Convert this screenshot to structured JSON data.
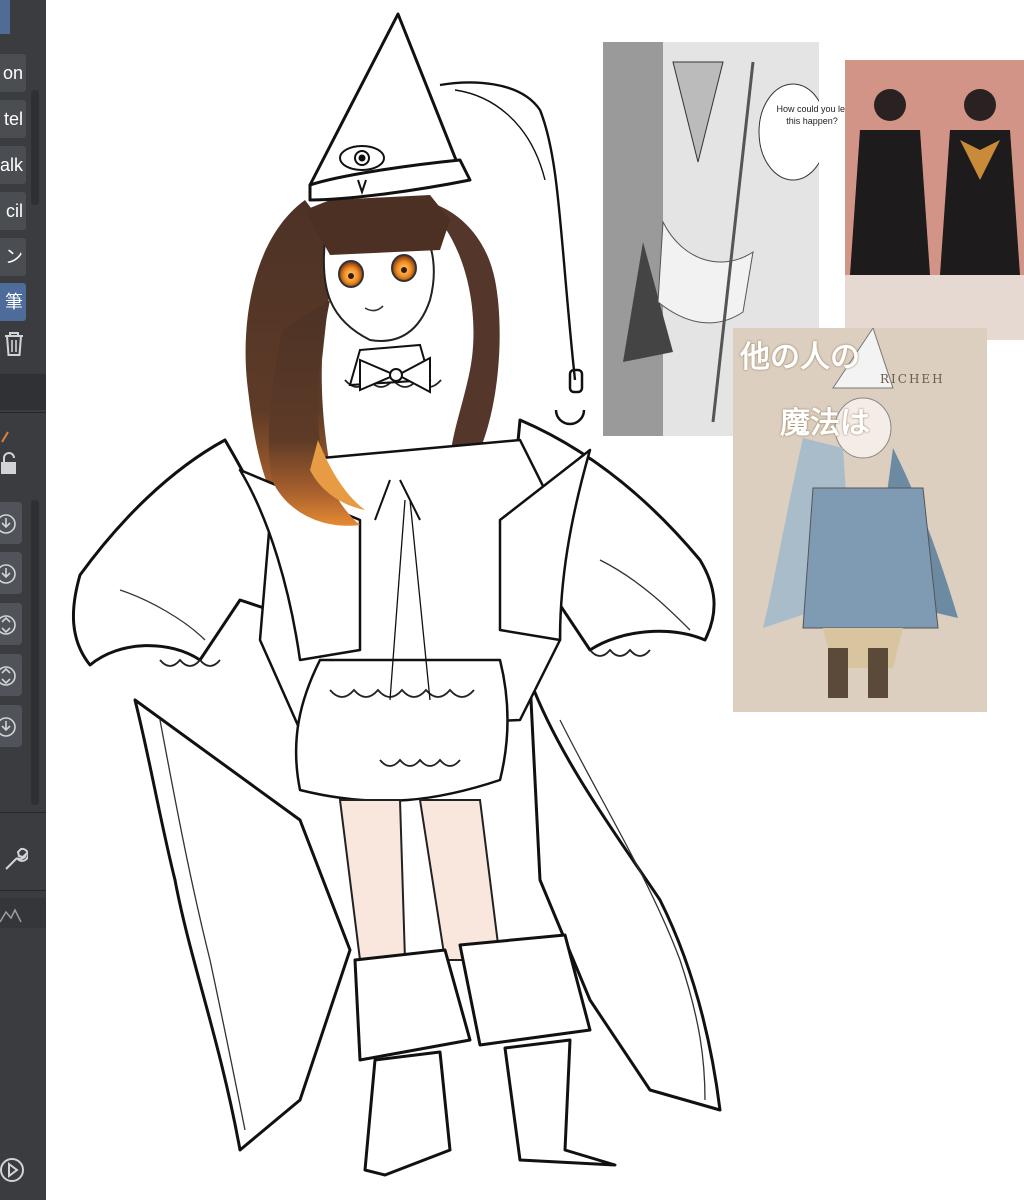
{
  "brush_panel": {
    "items": [
      {
        "label": "on",
        "active": false
      },
      {
        "label": "tel",
        "active": false
      },
      {
        "label": "alk",
        "active": false
      },
      {
        "label": "cil",
        "active": false
      },
      {
        "label": "ン",
        "active": false
      },
      {
        "label": "筆",
        "active": true
      }
    ],
    "icons": [
      "trash-icon",
      "pen-icon",
      "lock-icon",
      "download-icon",
      "download-icon",
      "stepper-icon",
      "stepper-icon",
      "download-icon",
      "wrench-icon",
      "mountain-icon",
      "play-icon"
    ]
  },
  "references": {
    "manga_speech": "How could you let this happen?",
    "cover_title_line1": "他の人の",
    "cover_title_line2": "魔法は",
    "cover_banner": "RICHEH"
  },
  "colors": {
    "panel_bg": "#3a3c40",
    "active_brush": "#4e6c99",
    "hair": "#5b3a2a",
    "hair_gradient": "#d8782a",
    "eye": "#e08a2a",
    "skin": "#f7e2d6"
  }
}
